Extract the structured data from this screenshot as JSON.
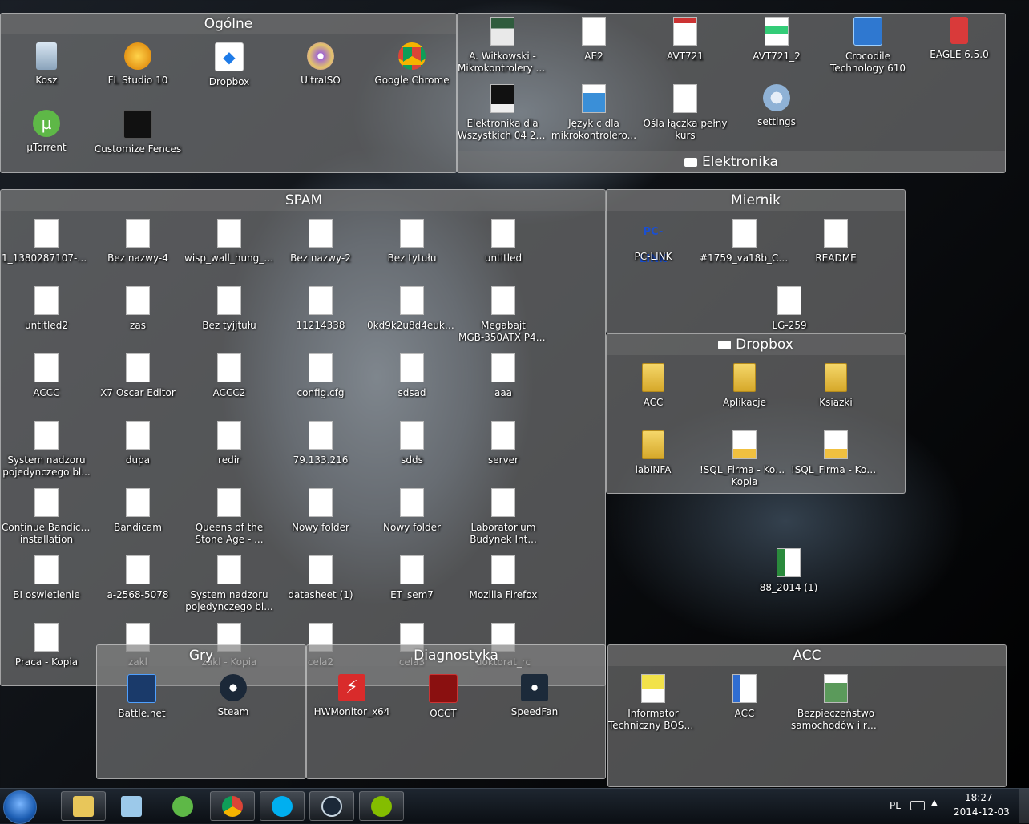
{
  "fences": {
    "ogolne": {
      "title": "Ogólne",
      "items": [
        "Kosz",
        "FL Studio 10",
        "Dropbox",
        "UltraISO",
        "Google Chrome",
        "µTorrent",
        "Customize Fences"
      ]
    },
    "elektronika": {
      "title": "Elektronika",
      "items": [
        [
          "A. Witkowski -",
          "Mikrokontrolery A..."
        ],
        [
          "AE2"
        ],
        [
          "AVT721"
        ],
        [
          "AVT721_2"
        ],
        [
          "Crocodile",
          "Technology 610"
        ],
        [
          "EAGLE 6.5.0"
        ],
        [
          "Elektronika dla",
          "Wszystkich 04 2014"
        ],
        [
          "Język c dla",
          "mikrokontrolero..."
        ],
        [
          "Ośla łączka pełny",
          "kurs"
        ],
        [
          "settings"
        ]
      ]
    },
    "spam": {
      "title": "SPAM",
      "items": [
        [
          "1_1380287107-521"
        ],
        [
          "Bez nazwy-4"
        ],
        [
          "wisp_wall_hung_t..."
        ],
        [
          "Bez nazwy-2"
        ],
        [
          "Bez tytułu"
        ],
        [
          "untitled"
        ],
        [
          "untitled2"
        ],
        [
          "zas"
        ],
        [
          "Bez tyjjtułu"
        ],
        [
          "11214338"
        ],
        [
          "0kd9k2u8d4eukh8..."
        ],
        [
          "Megabajt",
          "MGB-350ATX P4_..."
        ],
        [
          "ACCC"
        ],
        [
          "X7 Oscar Editor"
        ],
        [
          "ACCC2"
        ],
        [
          "config.cfg"
        ],
        [
          "sdsad"
        ],
        [
          "aaa"
        ],
        [
          "System nadzoru",
          "pojedynczego bl..."
        ],
        [
          "dupa"
        ],
        [
          "redir"
        ],
        [
          "79.133.216"
        ],
        [
          "sdds"
        ],
        [
          "server"
        ],
        [
          "Continue Bandicam",
          "installation"
        ],
        [
          "Bandicam"
        ],
        [
          "Queens of the",
          "Stone Age - ..."
        ],
        [
          "Nowy folder"
        ],
        [
          "Nowy folder"
        ],
        [
          "Laboratorium",
          "Budynek Int..."
        ],
        [
          "BI oswietlenie"
        ],
        [
          "a-2568-5078"
        ],
        [
          "System nadzoru",
          "pojedynczego bl..."
        ],
        [
          "datasheet (1)"
        ],
        [
          "ET_sem7"
        ],
        [
          "Mozilla Firefox"
        ],
        [
          "Praca - Kopia"
        ],
        [
          "zakl"
        ],
        [
          "zakl - Kopia"
        ],
        [
          "cela2"
        ],
        [
          "cela3"
        ],
        [
          "doktorat_rc"
        ]
      ]
    },
    "miernik": {
      "title": "Miernik",
      "items": [
        [
          "PC-LINK"
        ],
        [
          "#1759_va18b_CD..."
        ],
        [
          "README"
        ],
        [
          "LG-259"
        ]
      ]
    },
    "dropbox": {
      "title": "Dropbox",
      "items": [
        [
          "ACC"
        ],
        [
          "Aplikacje"
        ],
        [
          "Ksiazki"
        ],
        [
          "labINFA"
        ],
        [
          "!SQL_Firma - Kopia",
          "Kopia"
        ],
        [
          "!SQL_Firma - Kopia"
        ]
      ]
    },
    "gry": {
      "title": "Gry",
      "items": [
        [
          "Battle.net"
        ],
        [
          "Steam"
        ]
      ]
    },
    "diagnostyka": {
      "title": "Diagnostyka",
      "items": [
        [
          "HWMonitor_x64"
        ],
        [
          "OCCT"
        ],
        [
          "SpeedFan"
        ]
      ]
    },
    "acc": {
      "title": "ACC",
      "items": [
        [
          "Informator",
          "Techniczny BOSC..."
        ],
        [
          "ACC"
        ],
        [
          "Bezpieczeństwo",
          "samochodów i ru..."
        ]
      ]
    }
  },
  "desktop_loose": {
    "label": "88_2014 (1)"
  },
  "taskbar": {
    "language": "PL",
    "time": "18:27",
    "date": "2014-12-03",
    "pinned": [
      "explorer-icon",
      "notepad-icon",
      "utorrent-icon",
      "chrome-icon",
      "skype-icon",
      "steam-icon",
      "spotify-icon"
    ]
  }
}
